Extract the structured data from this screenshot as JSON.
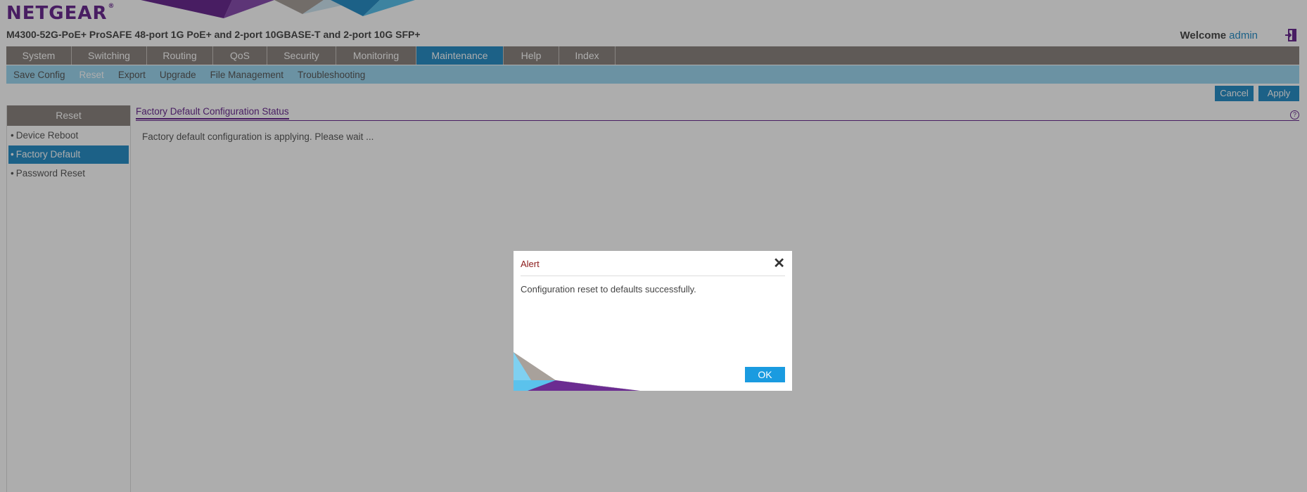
{
  "brand": {
    "logo": "NETGEAR",
    "logo_mark": "®",
    "accent": "#6b2c91",
    "highlight": "#2a8fc7"
  },
  "header": {
    "model": "M4300-52G-PoE+ ProSAFE 48-port 1G PoE+ and 2-port 10GBASE-T and 2-port 10G SFP+",
    "welcome": "Welcome",
    "user": "admin"
  },
  "mainnav": {
    "tabs": [
      {
        "label": "System"
      },
      {
        "label": "Switching"
      },
      {
        "label": "Routing"
      },
      {
        "label": "QoS"
      },
      {
        "label": "Security"
      },
      {
        "label": "Monitoring"
      },
      {
        "label": "Maintenance",
        "active": true
      },
      {
        "label": "Help"
      },
      {
        "label": "Index"
      }
    ]
  },
  "subnav": {
    "items": [
      {
        "label": "Save Config"
      },
      {
        "label": "Reset",
        "active": true
      },
      {
        "label": "Export"
      },
      {
        "label": "Upgrade"
      },
      {
        "label": "File Management"
      },
      {
        "label": "Troubleshooting"
      }
    ]
  },
  "actions": {
    "cancel": "Cancel",
    "apply": "Apply"
  },
  "leftpanel": {
    "header": "Reset",
    "items": [
      {
        "label": "Device Reboot"
      },
      {
        "label": "Factory Default",
        "active": true
      },
      {
        "label": "Password Reset"
      }
    ]
  },
  "content": {
    "title": "Factory Default Configuration Status",
    "help": "?",
    "message": "Factory default configuration is applying. Please wait ..."
  },
  "dialog": {
    "title": "Alert",
    "close": "✕",
    "message": "Configuration reset to defaults successfully.",
    "ok": "OK"
  }
}
